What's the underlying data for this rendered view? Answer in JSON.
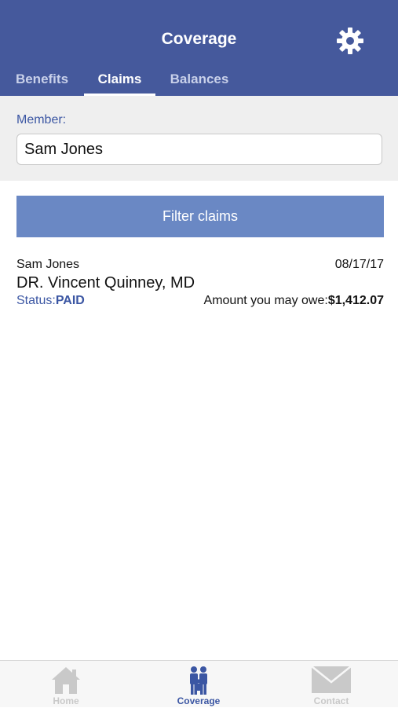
{
  "header": {
    "title": "Coverage",
    "settings_icon": "gear-icon",
    "background_color": "#45599c"
  },
  "tabs": [
    {
      "label": "Benefits",
      "active": false
    },
    {
      "label": "Claims",
      "active": true
    },
    {
      "label": "Balances",
      "active": false
    }
  ],
  "member": {
    "label": "Member:",
    "value": "Sam Jones"
  },
  "filter": {
    "button_label": "Filter claims",
    "button_color": "#6a88c4"
  },
  "claims": [
    {
      "member": "Sam Jones",
      "date": "08/17/17",
      "provider": "DR. Vincent Quinney, MD",
      "status_label": "Status:",
      "status_value": "PAID",
      "owe_label": "Amount you may owe:",
      "owe_value": "$1,412.07"
    }
  ],
  "bottom_nav": [
    {
      "label": "Home",
      "icon": "home-icon",
      "active": false
    },
    {
      "label": "Coverage",
      "icon": "family-icon",
      "active": true
    },
    {
      "label": "Contact",
      "icon": "envelope-icon",
      "active": false
    }
  ],
  "colors": {
    "accent": "#3b56a3",
    "inactive": "#c9c9c9"
  }
}
